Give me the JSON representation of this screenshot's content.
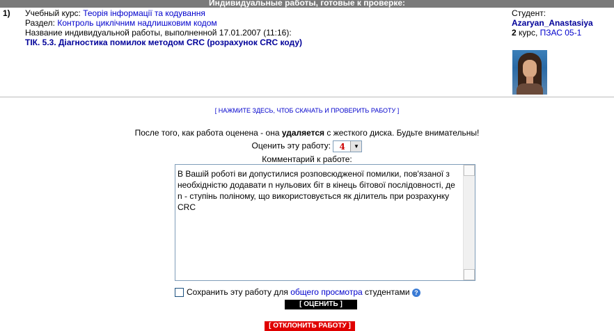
{
  "header": {
    "title": "Индивидуальные работы, готовые к проверке:"
  },
  "work": {
    "number": "1)",
    "course_label": "Учебный курс:",
    "course": "Теорія інформації та кодування",
    "section_label": "Раздел:",
    "section": "Контроль циклічним надлишковим кодом",
    "submitted_text": "Название индивидуальной работы, выполненной 17.01.2007 (11:16):",
    "title": "ТІК. 5.3. Діагностика помилок методом CRC (розрахунок CRC коду)"
  },
  "student": {
    "label": "Студент:",
    "name": "Azaryan_Anastasiya",
    "year": "2",
    "year_suffix": "курс,",
    "group": "ПЗАС 05-1"
  },
  "actions": {
    "download": "[ НАЖМИТЕ ЗДЕСЬ, ЧТОБ СКАЧАТЬ И ПРОВЕРИТЬ РАБОТУ ]",
    "warning_pre": "После того, как работа оценена - она ",
    "warning_bold": "удаляется",
    "warning_post": " с жесткого диска. Будьте внимательны!",
    "grade_label": "Оценить эту работу:",
    "grade_value": "4",
    "comment_label": "Комментарий к работе:",
    "comment_text": "В Вашій роботі ви допустилися розповсюдженої помилки, пов'язаної з необхідністю додавати n нульових біт в кінець бітової послідовності, де n - ступінь поліному, що використовується як ділитель при розрахунку CRC",
    "save_pre": "Сохранить эту работу для ",
    "save_link": "общего просмотра",
    "save_post": " студентами",
    "evaluate_button": "[ ОЦЕНИТЬ ]",
    "reject_button": "[ ОТКЛОНИТЬ РАБОТУ ]"
  }
}
